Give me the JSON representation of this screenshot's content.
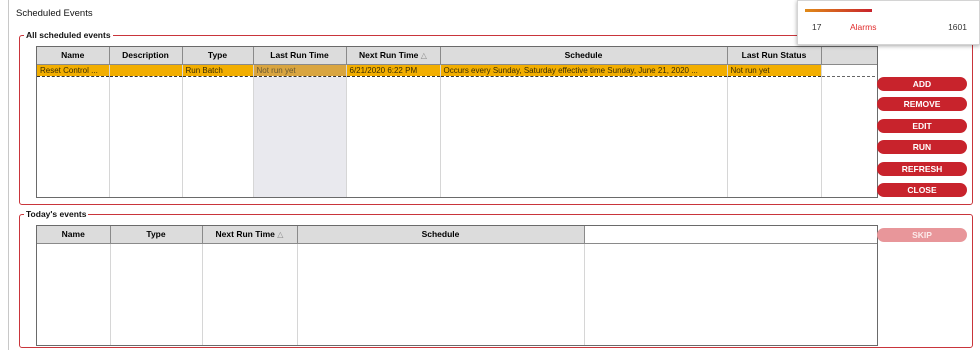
{
  "window": {
    "title": "Scheduled Events"
  },
  "all_events": {
    "label": "All scheduled events",
    "columns": [
      "Name",
      "Description",
      "Type",
      "Last Run Time",
      "Next Run Time",
      "Schedule",
      "Last Run Status"
    ],
    "rows": [
      {
        "name": "Reset Control ...",
        "description": "",
        "type": "Run Batch",
        "last_run_time": "Not run yet",
        "next_run_time": "6/21/2020 6:22 PM",
        "schedule": "Occurs every Sunday, Saturday effective time Sunday, June 21, 2020 ...",
        "last_run_status": "Not run yet"
      }
    ],
    "sorted_column": "Next Run Time"
  },
  "todays_events": {
    "label": "Today's events",
    "columns": [
      "Name",
      "Type",
      "Next Run Time",
      "Schedule"
    ],
    "rows": [],
    "sorted_column": "Next Run Time"
  },
  "buttons": {
    "add": "ADD",
    "remove": "REMOVE",
    "edit": "EDIT",
    "run": "RUN",
    "refresh": "REFRESH",
    "close": "CLOSE",
    "skip": "SKIP"
  },
  "alarm_popup": {
    "count": "17",
    "label": "Alarms",
    "value": "1601"
  },
  "colors": {
    "accent": "#c8232c",
    "selected_row": "#f2ae00"
  }
}
